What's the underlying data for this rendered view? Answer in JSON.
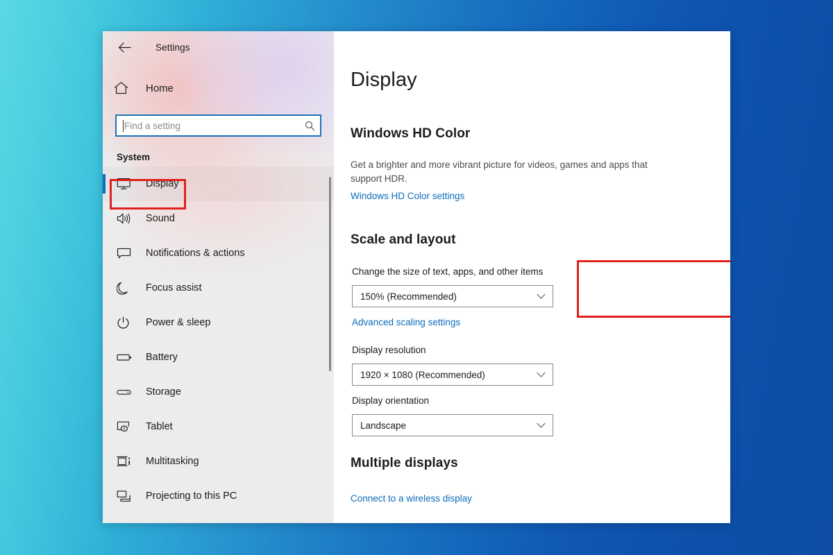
{
  "window": {
    "app_title": "Settings",
    "back_icon": "back-arrow-icon"
  },
  "sidebar": {
    "home_label": "Home",
    "home_icon": "home-icon",
    "search": {
      "placeholder": "Find a setting",
      "value": "",
      "icon": "search-icon"
    },
    "group_title": "System",
    "items": [
      {
        "label": "Display",
        "icon": "monitor-icon",
        "selected": true
      },
      {
        "label": "Sound",
        "icon": "speaker-icon",
        "selected": false
      },
      {
        "label": "Notifications & actions",
        "icon": "notification-icon",
        "selected": false
      },
      {
        "label": "Focus assist",
        "icon": "moon-icon",
        "selected": false
      },
      {
        "label": "Power & sleep",
        "icon": "power-icon",
        "selected": false
      },
      {
        "label": "Battery",
        "icon": "battery-icon",
        "selected": false
      },
      {
        "label": "Storage",
        "icon": "storage-icon",
        "selected": false
      },
      {
        "label": "Tablet",
        "icon": "tablet-icon",
        "selected": false
      },
      {
        "label": "Multitasking",
        "icon": "multitasking-icon",
        "selected": false
      },
      {
        "label": "Projecting to this PC",
        "icon": "projecting-icon",
        "selected": false
      }
    ]
  },
  "main": {
    "page_title": "Display",
    "hd_color": {
      "heading": "Windows HD Color",
      "description": "Get a brighter and more vibrant picture for videos, games and apps that support HDR.",
      "link": "Windows HD Color settings"
    },
    "scale_and_layout": {
      "heading": "Scale and layout",
      "scale_label": "Change the size of text, apps, and other items",
      "scale_value": "150% (Recommended)",
      "advanced_link": "Advanced scaling settings",
      "resolution_label": "Display resolution",
      "resolution_value": "1920 × 1080 (Recommended)",
      "orientation_label": "Display orientation",
      "orientation_value": "Landscape"
    },
    "multiple_displays": {
      "heading": "Multiple displays",
      "link": "Connect to a wireless display"
    }
  },
  "annotations": {
    "highlight_color": "#e0201b",
    "accent_color": "#0d6cbd",
    "boxes": [
      "display-nav-item",
      "scale-and-layout-control"
    ]
  }
}
